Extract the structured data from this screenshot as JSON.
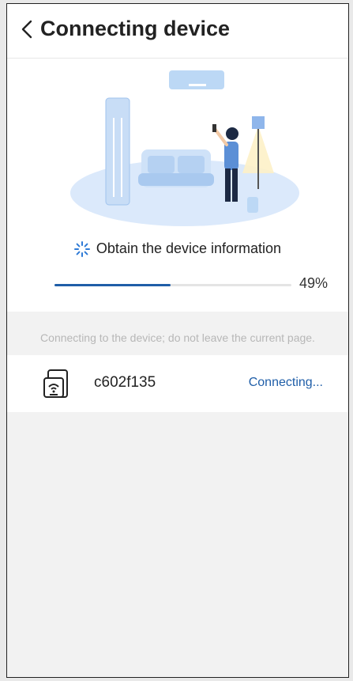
{
  "header": {
    "title": "Connecting device",
    "back_icon": "chevron-left-icon"
  },
  "illustration": {
    "name": "living-room-ac-illustration"
  },
  "status": {
    "text": "Obtain the device information",
    "icon": "spinner-icon"
  },
  "progress": {
    "value": 49,
    "label": "49%",
    "color": "#1f5ea8"
  },
  "notice": "Connecting to the device; do not leave the current page.",
  "device": {
    "name": "c602f135",
    "status": "Connecting...",
    "icon": "wifi-device-icon"
  },
  "colors": {
    "accent": "#1f5ea8",
    "background": "#f2f2f2"
  }
}
